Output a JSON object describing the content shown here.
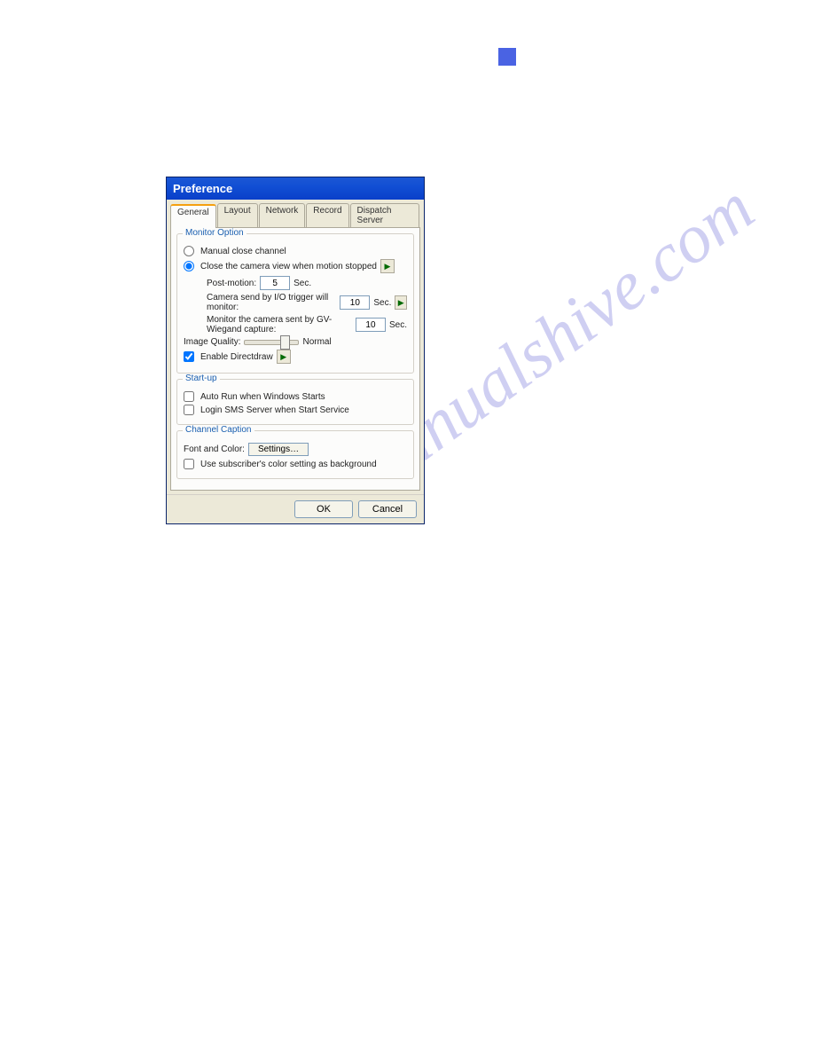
{
  "watermark": "manualshive.com",
  "dialog": {
    "title": "Preference",
    "tabs": [
      "General",
      "Layout",
      "Network",
      "Record",
      "Dispatch Server"
    ],
    "monitor_option": {
      "legend": "Monitor Option",
      "radio_manual": "Manual close channel",
      "radio_close": "Close the camera view when motion stopped",
      "post_motion_label": "Post-motion:",
      "post_motion_value": "5",
      "post_motion_unit": "Sec.",
      "io_trigger_label": "Camera send by I/O trigger will monitor:",
      "io_trigger_value": "10",
      "io_trigger_unit": "Sec.",
      "wiegand_label": "Monitor the camera sent by GV-Wiegand capture:",
      "wiegand_value": "10",
      "wiegand_unit": "Sec.",
      "image_quality_label": "Image Quality:",
      "image_quality_value": "Normal",
      "enable_directdraw": "Enable Directdraw"
    },
    "startup": {
      "legend": "Start-up",
      "auto_run": "Auto Run when Windows Starts",
      "login_sms": "Login SMS Server when Start Service"
    },
    "channel_caption": {
      "legend": "Channel Caption",
      "font_color_label": "Font and Color:",
      "settings_btn": "Settings…",
      "use_subscriber": "Use subscriber's color setting as background"
    },
    "buttons": {
      "ok": "OK",
      "cancel": "Cancel"
    }
  }
}
